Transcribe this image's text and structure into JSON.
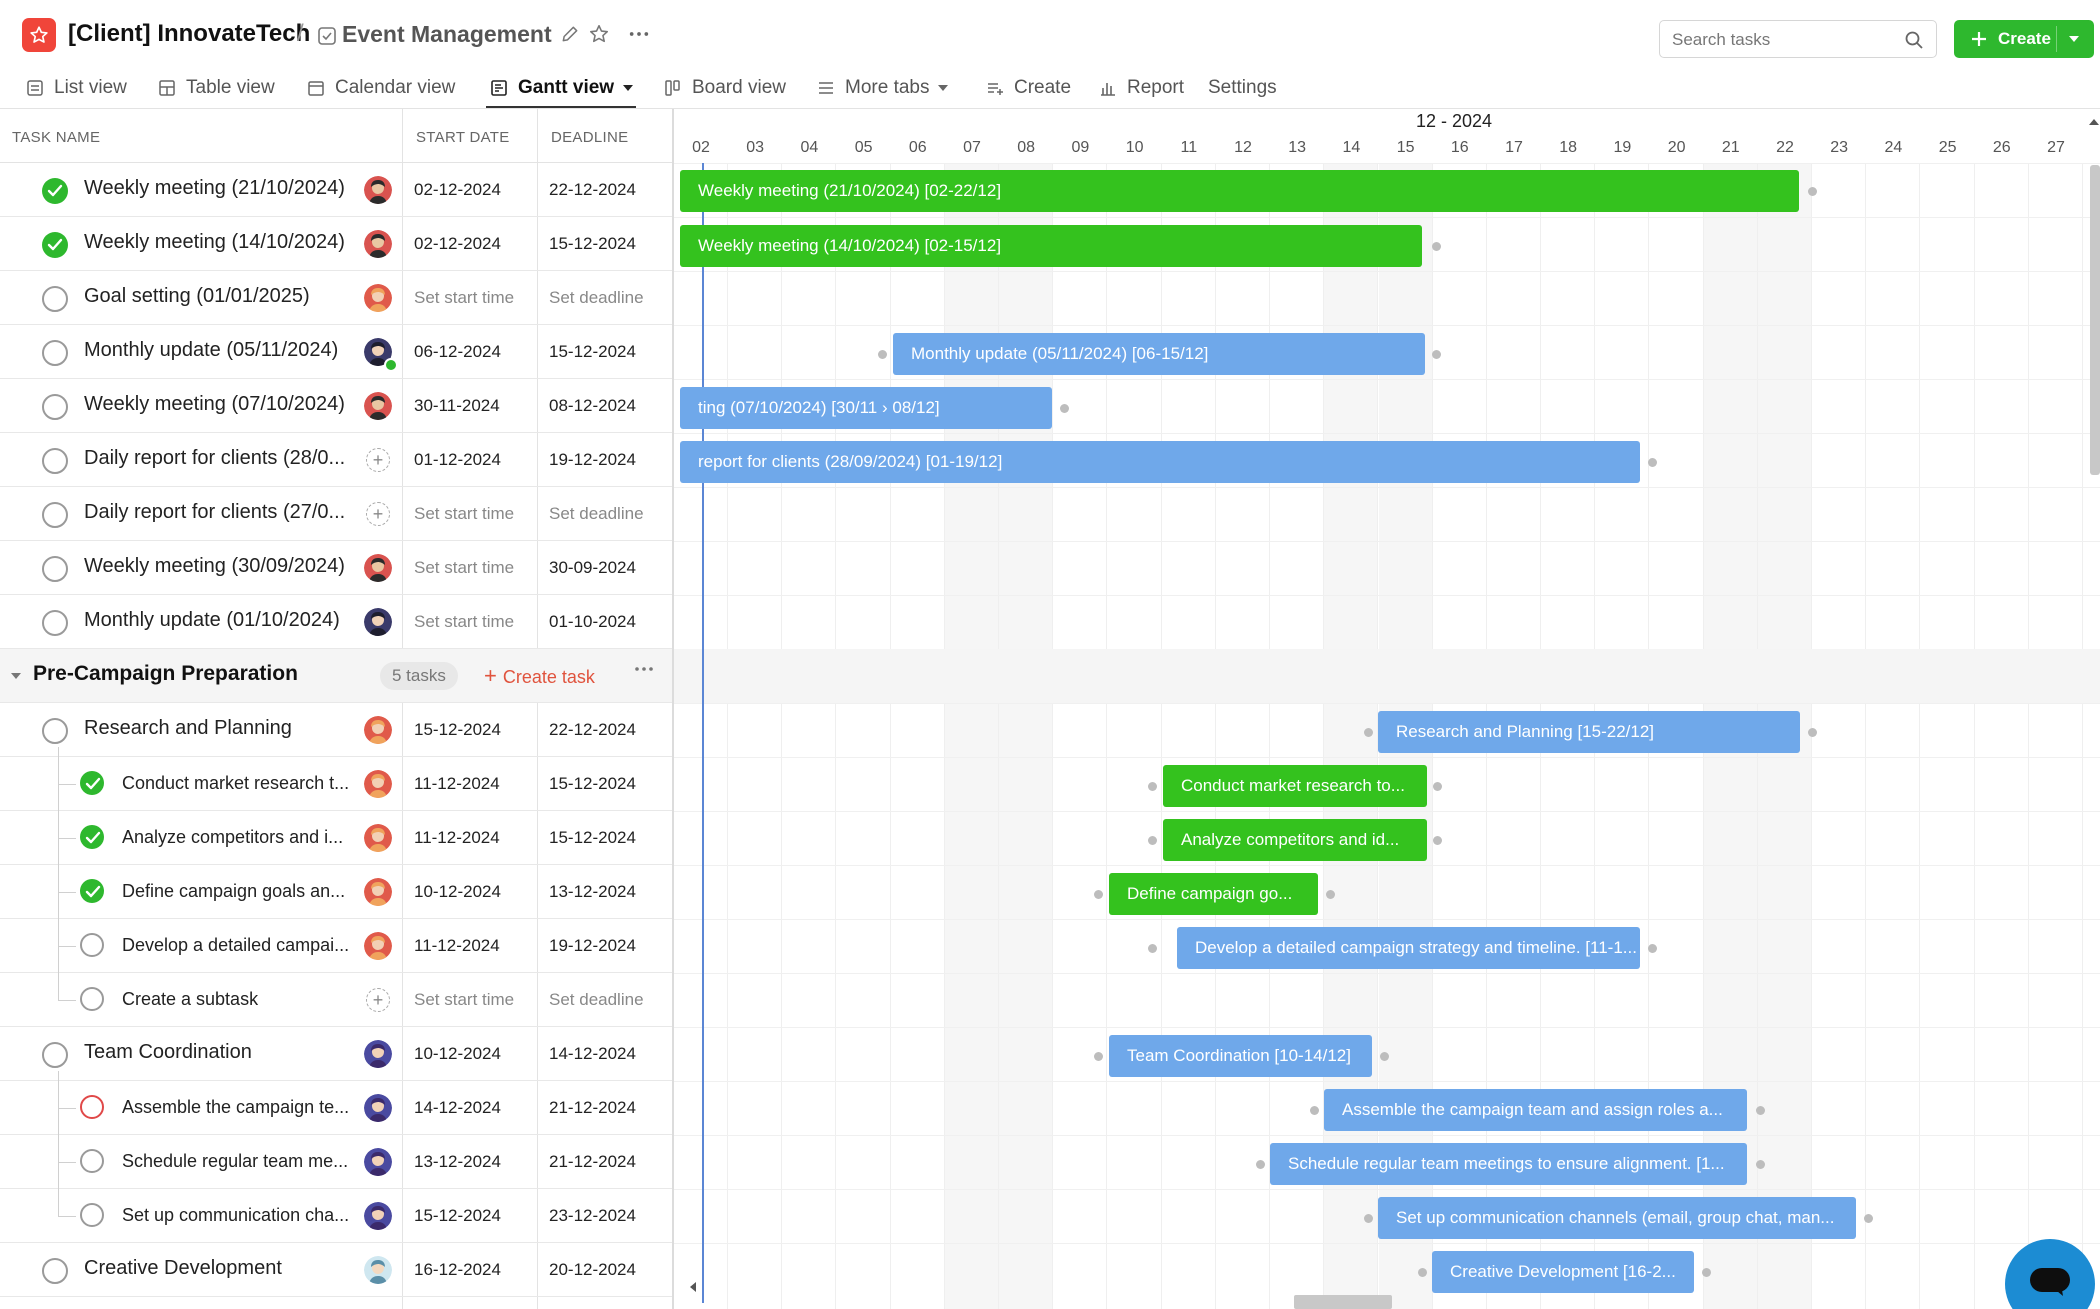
{
  "header": {
    "client": "[Client] InnovateTech",
    "separator": "/",
    "project": "Event Management",
    "search_placeholder": "Search tasks",
    "create_label": "Create"
  },
  "tabs": [
    {
      "label": "List view"
    },
    {
      "label": "Table view"
    },
    {
      "label": "Calendar view"
    },
    {
      "label": "Gantt view"
    },
    {
      "label": "Board view"
    },
    {
      "label": "More tabs"
    },
    {
      "label": "Create"
    },
    {
      "label": "Report"
    },
    {
      "label": "Settings"
    }
  ],
  "table": {
    "col_task": "TASK NAME",
    "col_start": "START DATE",
    "col_deadline": "DEADLINE"
  },
  "rows": [
    {
      "name": "Weekly meeting (21/10/2024)",
      "start": "02-12-2024",
      "deadline": "22-12-2024"
    },
    {
      "name": "Weekly meeting (14/10/2024)",
      "start": "02-12-2024",
      "deadline": "15-12-2024"
    },
    {
      "name": "Goal setting (01/01/2025)",
      "start": "Set start time",
      "deadline": "Set deadline"
    },
    {
      "name": "Monthly update (05/11/2024)",
      "start": "06-12-2024",
      "deadline": "15-12-2024"
    },
    {
      "name": "Weekly meeting (07/10/2024)",
      "start": "30-11-2024",
      "deadline": "08-12-2024"
    },
    {
      "name": "Daily report for clients (28/0...",
      "start": "01-12-2024",
      "deadline": "19-12-2024"
    },
    {
      "name": "Daily report for clients (27/0...",
      "start": "Set start time",
      "deadline": "Set deadline"
    },
    {
      "name": "Weekly meeting (30/09/2024)",
      "start": "Set start time",
      "deadline": "30-09-2024"
    },
    {
      "name": "Monthly update (01/10/2024)",
      "start": "Set start time",
      "deadline": "01-10-2024"
    }
  ],
  "group": {
    "title": "Pre-Campaign Preparation",
    "count": "5 tasks",
    "create_task": "Create task",
    "plus": "+"
  },
  "group_rows": [
    {
      "name": "Research and Planning",
      "start": "15-12-2024",
      "deadline": "22-12-2024"
    },
    {
      "name": "Conduct market research t...",
      "start": "11-12-2024",
      "deadline": "15-12-2024"
    },
    {
      "name": "Analyze competitors and i...",
      "start": "11-12-2024",
      "deadline": "15-12-2024"
    },
    {
      "name": "Define campaign goals an...",
      "start": "10-12-2024",
      "deadline": "13-12-2024"
    },
    {
      "name": "Develop a detailed campai...",
      "start": "11-12-2024",
      "deadline": "19-12-2024"
    },
    {
      "name": "Create a subtask",
      "start": "Set start time",
      "deadline": "Set deadline"
    },
    {
      "name": "Team Coordination",
      "start": "10-12-2024",
      "deadline": "14-12-2024"
    },
    {
      "name": "Assemble the campaign te...",
      "start": "14-12-2024",
      "deadline": "21-12-2024"
    },
    {
      "name": "Schedule regular team me...",
      "start": "13-12-2024",
      "deadline": "21-12-2024"
    },
    {
      "name": "Set up communication cha...",
      "start": "15-12-2024",
      "deadline": "23-12-2024"
    },
    {
      "name": "Creative Development",
      "start": "16-12-2024",
      "deadline": "20-12-2024"
    }
  ],
  "gantt": {
    "month": "12 - 2024",
    "days": [
      "02",
      "03",
      "04",
      "05",
      "06",
      "07",
      "08",
      "09",
      "10",
      "11",
      "12",
      "13",
      "14",
      "15",
      "16",
      "17",
      "18",
      "19",
      "20",
      "21",
      "22",
      "23",
      "24",
      "25",
      "26",
      "27"
    ],
    "bars": [
      {
        "label": "Weekly meeting (21/10/2024) [02-22/12]",
        "color": "green"
      },
      {
        "label": "Weekly meeting (14/10/2024) [02-15/12]",
        "color": "green"
      },
      {
        "label": "Monthly update (05/11/2024) [06-15/12]",
        "color": "blue"
      },
      {
        "label": "ting (07/10/2024) [30/11 › 08/12]",
        "color": "blue"
      },
      {
        "label": "report for clients (28/09/2024) [01-19/12]",
        "color": "blue"
      },
      {
        "label": "Research and Planning [15-22/12]",
        "color": "blue"
      },
      {
        "label": "Conduct market research to...",
        "color": "green"
      },
      {
        "label": "Analyze competitors and id...",
        "color": "green"
      },
      {
        "label": "Define campaign go...",
        "color": "green"
      },
      {
        "label": "Develop a detailed campaign strategy and timeline. [11-1...",
        "color": "blue"
      },
      {
        "label": "Team Coordination [10-14/12]",
        "color": "blue"
      },
      {
        "label": "Assemble the campaign team and assign roles a...",
        "color": "blue"
      },
      {
        "label": "Schedule regular team meetings to ensure alignment. [1...",
        "color": "blue"
      },
      {
        "label": "Set up communication channels (email, group chat, man...",
        "color": "blue"
      },
      {
        "label": "Creative Development [16-2...",
        "color": "blue"
      }
    ]
  },
  "colors": {
    "accent_green": "#34c21e",
    "bar_blue": "#6fa8ea",
    "logo_red": "#f0453a",
    "create_red": "#e0533d"
  },
  "icons": [
    "star-icon",
    "checklist-icon",
    "pencil-icon",
    "star-outline-icon",
    "more-icon",
    "search-icon",
    "plus-icon",
    "caret-down-icon",
    "list-icon",
    "table-icon",
    "calendar-icon",
    "gantt-icon",
    "board-icon",
    "menu-icon",
    "create-icon",
    "report-icon",
    "chat-icon"
  ]
}
